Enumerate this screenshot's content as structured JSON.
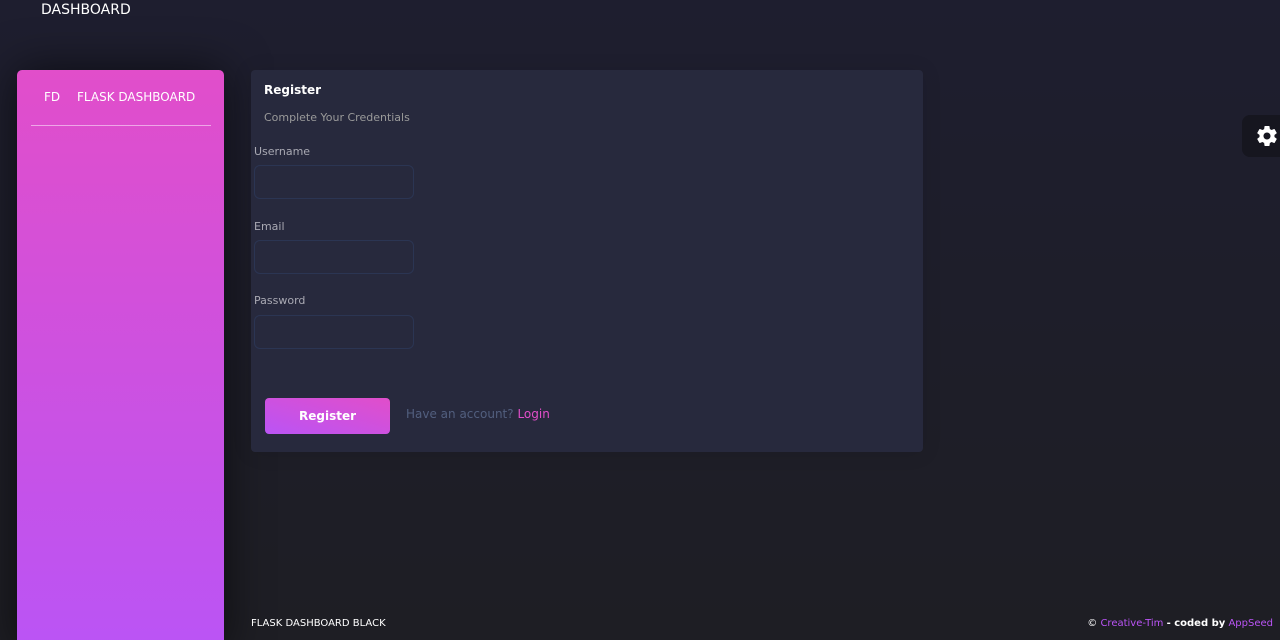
{
  "navbar": {
    "brand": "DASHBOARD"
  },
  "sidebar": {
    "logo_mini": "FD",
    "logo_text": "FLASK DASHBOARD"
  },
  "card": {
    "title": "Register",
    "subtitle": "Complete Your Credentials",
    "fields": [
      {
        "label": "Username",
        "value": "",
        "placeholder": ""
      },
      {
        "label": "Email",
        "value": "",
        "placeholder": ""
      },
      {
        "label": "Password",
        "value": "",
        "placeholder": ""
      }
    ],
    "register_label": "Register",
    "account_prompt": "Have an account?",
    "login_label": "Login"
  },
  "settings": {
    "icon": "gear-icon"
  },
  "footer": {
    "left": "FLASK DASHBOARD BLACK",
    "copyright": "©",
    "creative_tim": "Creative-Tim",
    "coded_by": "- coded by",
    "appseed": "AppSeed"
  },
  "colors": {
    "primary": "#e14eca",
    "secondary": "#ba54f5",
    "background": "#1e1e2f",
    "card": "#27293d"
  }
}
